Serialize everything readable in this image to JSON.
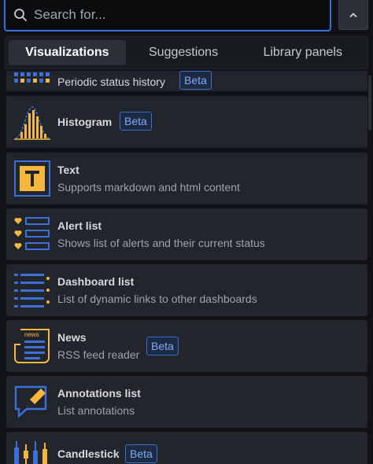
{
  "search": {
    "placeholder": "Search for..."
  },
  "tabs": [
    {
      "label": "Visualizations",
      "active": true
    },
    {
      "label": "Suggestions",
      "active": false
    },
    {
      "label": "Library panels",
      "active": false
    }
  ],
  "visualizations": [
    {
      "title": "Periodic status history",
      "description": "",
      "badge": "Beta",
      "icon": "status-history-icon"
    },
    {
      "title": "Histogram",
      "description": "",
      "badge": "Beta",
      "icon": "histogram-icon"
    },
    {
      "title": "Text",
      "description": "Supports markdown and html content",
      "badge": "",
      "icon": "text-icon"
    },
    {
      "title": "Alert list",
      "description": "Shows list of alerts and their current status",
      "badge": "",
      "icon": "alert-list-icon"
    },
    {
      "title": "Dashboard list",
      "description": "List of dynamic links to other dashboards",
      "badge": "",
      "icon": "dashboard-list-icon"
    },
    {
      "title": "News",
      "description": "RSS feed reader",
      "badge": "Beta",
      "icon": "news-icon",
      "icon_text": "news"
    },
    {
      "title": "Annotations list",
      "description": "List annotations",
      "badge": "",
      "icon": "annotations-list-icon"
    },
    {
      "title": "Candlestick",
      "description": "",
      "badge": "Beta",
      "icon": "candlestick-icon"
    }
  ],
  "colors": {
    "accent": "#3871dc",
    "icon_blue": "#3d71d9",
    "icon_yellow": "#f5b73d",
    "panel_bg": "#22252b"
  }
}
